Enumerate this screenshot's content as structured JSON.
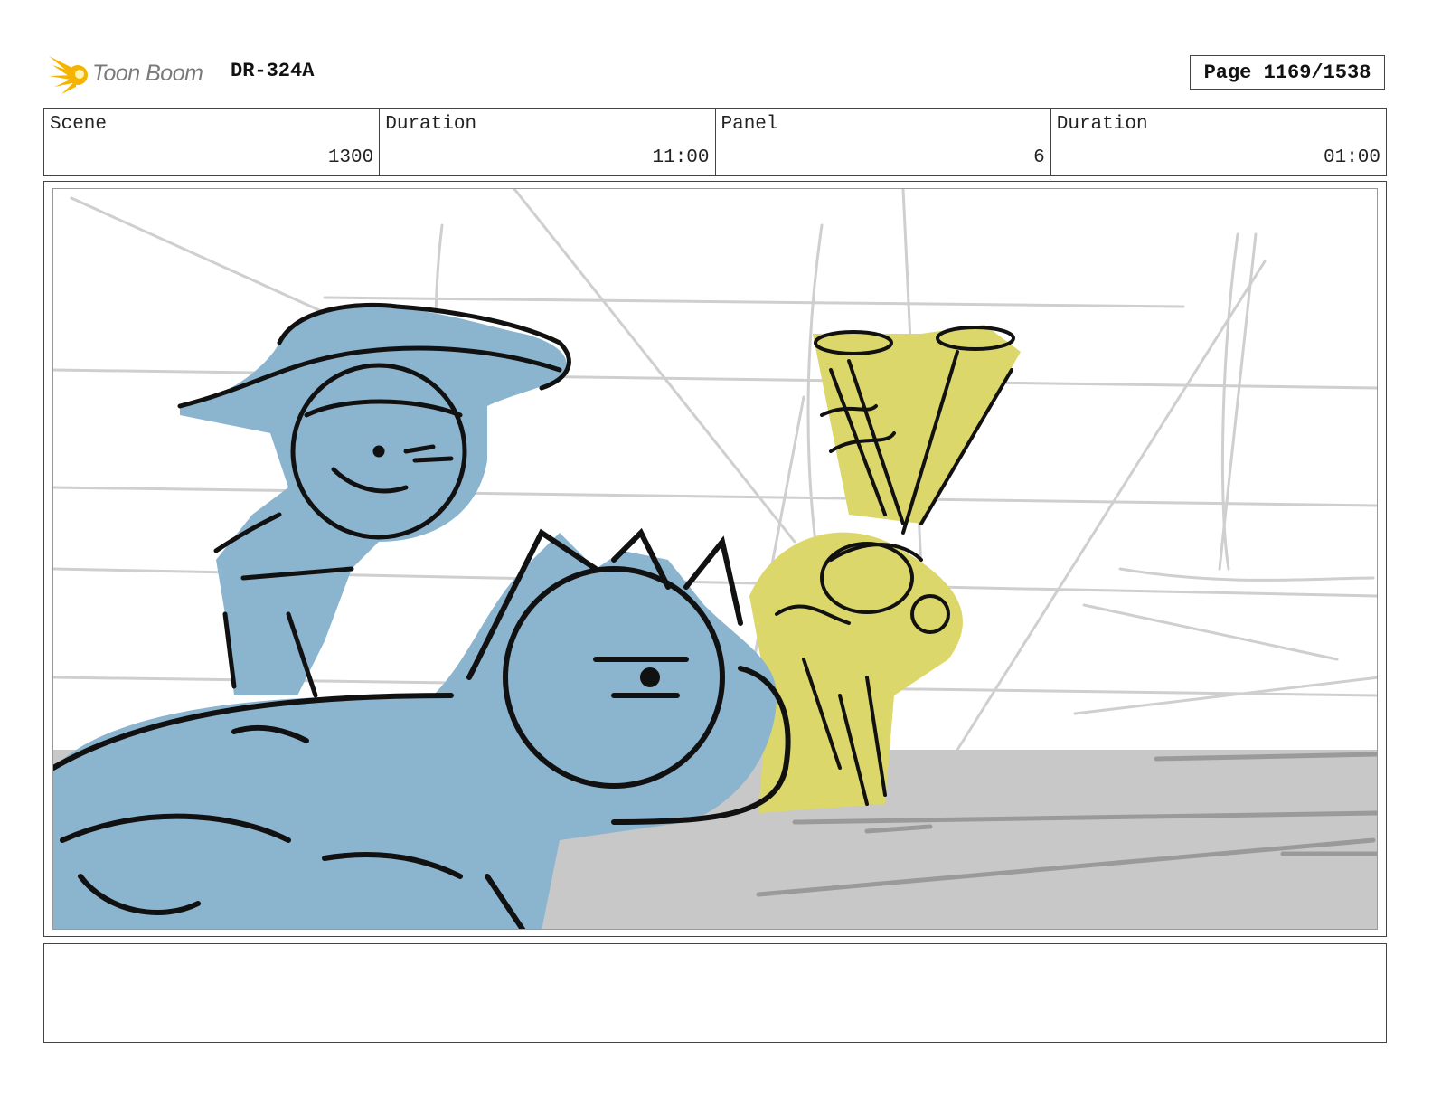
{
  "header": {
    "logo_text": "Toon Boom",
    "doc_id": "DR-324A",
    "page_label": "Page 1169/1538"
  },
  "info": {
    "scene_label": "Scene",
    "scene_value": "1300",
    "scene_duration_label": "Duration",
    "scene_duration_value": "11:00",
    "panel_label": "Panel",
    "panel_value": "6",
    "panel_duration_label": "Duration",
    "panel_duration_value": "01:00"
  },
  "colors": {
    "character_blue": "#8bb4cf",
    "character_yellow": "#dcd76a",
    "ground_gray": "#c8c8c8",
    "sketch_gray": "#cfcfcf",
    "logo_orange": "#f6b400"
  },
  "icons": [
    "toon-boom-logo-icon"
  ],
  "notes": ""
}
